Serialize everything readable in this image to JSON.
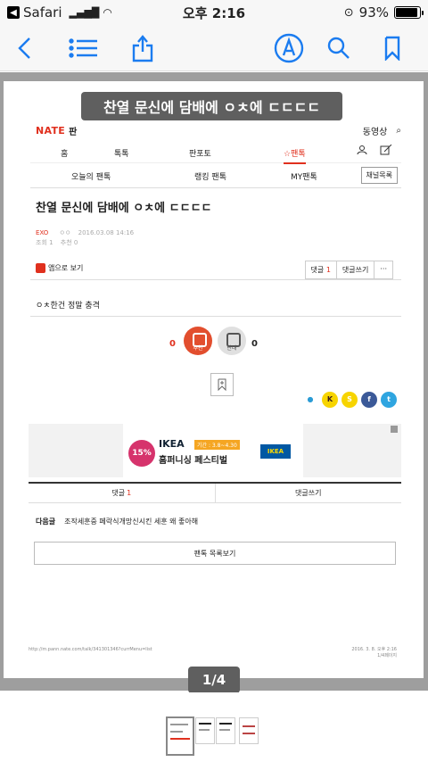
{
  "status": {
    "back_app": "Safari",
    "time": "오후 2:16",
    "battery_pct": "93%",
    "battery_level": 0.93
  },
  "toolbar": {
    "icons": [
      "back-chevron-icon",
      "list-icon",
      "share-icon",
      "markup-icon",
      "search-icon",
      "bookmark-icon"
    ]
  },
  "overlay": {
    "title": "찬열 문신에 담배에 ㅇㅊ에 ㄷㄷㄷㄷ",
    "page_indicator": "1/4"
  },
  "page": {
    "nate_logo": "NATE",
    "section": "판",
    "top_right": "동영상",
    "nav": [
      "홈",
      "톡톡",
      "판포토",
      "☆팬톡"
    ],
    "subnav": [
      "오늘의 팬톡",
      "랭킹 팬톡",
      "MY팬톡"
    ],
    "channel_button": "채널목록",
    "post_title": "찬열 문신에 담배에 ㅇㅊ에 ㄷㄷㄷㄷ",
    "author_tag": "EXO",
    "author": "ㅇㅇ",
    "date": "2016.03.08 14:16",
    "views": "조회 1",
    "recommend": "추천 0",
    "app_open": "앱으로 보기",
    "comment_label": "댓글",
    "comment_count": "1",
    "write_comment": "댓글쓰기",
    "more": "···",
    "body": "ㅇㅊ한건 정말 충격",
    "like_count": "0",
    "like_label": "추천",
    "dislike_count": "0",
    "dislike_label": "반대",
    "share_icons": [
      "talk",
      "K",
      "S",
      "f",
      "t"
    ],
    "ad": {
      "discount": "15%",
      "brand": "IKEA",
      "period": "기간 : 3.8~4.30",
      "slogan": "홈퍼니싱 페스티벌",
      "logo": "IKEA"
    },
    "tab_comments": "댓글",
    "tab_comments_count": "1",
    "tab_write": "댓글쓰기",
    "next_label": "다음글",
    "next_title": "조작세훈중 페락식개망신시킨 세훈 왜 좋아해",
    "list_button": "팬톡 목록보기",
    "footer_url": "http://m.pann.nate.com/talk/341301346?currMenu=list",
    "footer_date": "2016. 3. 8. 오후 2:16",
    "footer_page": "1/4페이지"
  },
  "colors": {
    "accent_blue": "#1b7cf0",
    "nate_red": "#e0301e"
  }
}
